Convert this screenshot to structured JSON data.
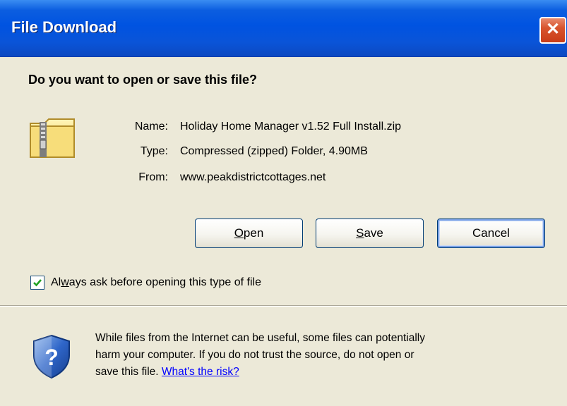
{
  "window": {
    "title": "File Download",
    "close_glyph": "✕"
  },
  "prompt": {
    "heading": "Do you want to open or save this file?"
  },
  "file_info": {
    "icon": "zip-folder-icon",
    "name_label": "Name:",
    "name_value": "Holiday Home Manager v1.52 Full Install.zip",
    "type_label": "Type:",
    "type_value": "Compressed (zipped) Folder, 4.90MB",
    "from_label": "From:",
    "from_value": "www.peakdistrictcottages.net"
  },
  "buttons": {
    "open": {
      "mnemonic": "O",
      "rest": "pen"
    },
    "save": {
      "mnemonic": "S",
      "rest": "ave"
    },
    "cancel": "Cancel"
  },
  "always_ask": {
    "checked": true,
    "label_pre": "Al",
    "label_mnemonic": "w",
    "label_post": "ays ask before opening this type of file"
  },
  "warning": {
    "icon": "security-shield-icon",
    "line1": "While files from the Internet can be useful, some files can potentially",
    "line2": "harm your computer. If you do not trust the source, do not open or",
    "line3_pre": "save this file.",
    "link": "What's the risk?"
  },
  "colors": {
    "titlebar": "#0053e1",
    "dialog_bg": "#ece9d8",
    "link": "#0000ff",
    "close_button": "#d8542e"
  }
}
